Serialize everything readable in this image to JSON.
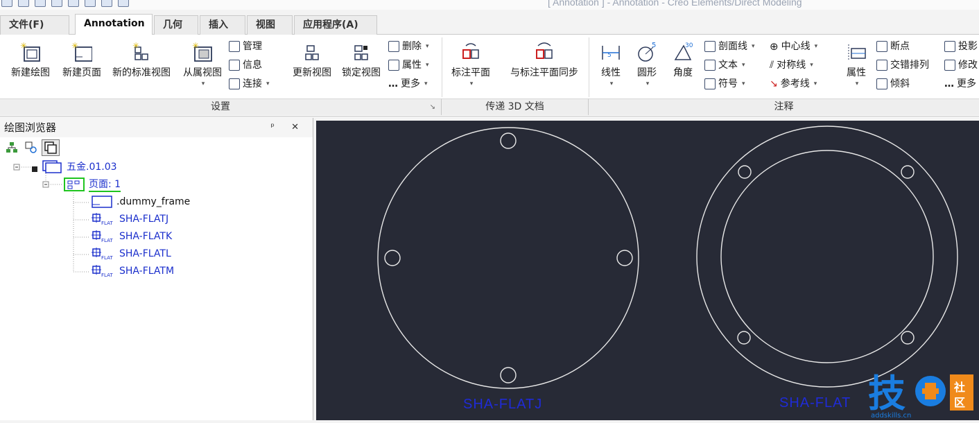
{
  "window": {
    "title": "[ Annotation ] - Annotation - Creo Elements/Direct Modeling"
  },
  "tabs": [
    {
      "label": "文件(F)",
      "active": false
    },
    {
      "label": "Annotation",
      "active": true
    },
    {
      "label": "几何",
      "active": false
    },
    {
      "label": "插入",
      "active": false
    },
    {
      "label": "视图",
      "active": false
    },
    {
      "label": "应用程序(A)",
      "active": false
    }
  ],
  "ribbon": {
    "setup": {
      "group_label": "设置",
      "new_drawing": "新建绘图",
      "new_page": "新建页面",
      "new_std_view": "新的标准视图",
      "sub_view": "从属视图",
      "manage": "管理",
      "info": "信息",
      "connect": "连接",
      "update_view": "更新视图",
      "lock_view": "锁定视图",
      "delete": "删除",
      "properties": "属性",
      "more": "更多"
    },
    "pass3d": {
      "group_label": "传递 3D 文档",
      "annot_plane": "标注平面",
      "sync_plane": "与标注平面同步"
    },
    "annot": {
      "group_label": "注释",
      "linear": "线性",
      "circle": "圆形",
      "angle": "角度",
      "section_line": "剖面线",
      "text": "文本",
      "symbol": "符号",
      "center_line": "中心线",
      "sym_line": "对称线",
      "ref_line": "参考线",
      "attr": "属性",
      "break_point": "断点",
      "stagger": "交错排列",
      "oblique": "倾斜",
      "project": "投影",
      "modify": "修改",
      "more2": "更多"
    }
  },
  "browser": {
    "title": "绘图浏览器",
    "pins": "ᵖ ✕",
    "tree": {
      "root": "五金.01.03",
      "page": "页面: 1",
      "items": [
        ".dummy_frame",
        "SHA-FLATJ",
        "SHA-FLATK",
        "SHA-FLATL",
        "SHA-FLATM"
      ]
    }
  },
  "canvas": {
    "labels": [
      "SHA-FLATJ",
      "SHA-FLAT"
    ]
  },
  "watermark": {
    "text": "技",
    "sub": "社区",
    "url": "addskills.cn"
  },
  "colors": {
    "canvas_bg": "#272a36",
    "geometry": "#e8e8e8",
    "label": "#1f2bd6",
    "tree_link": "#1a2ecc"
  }
}
